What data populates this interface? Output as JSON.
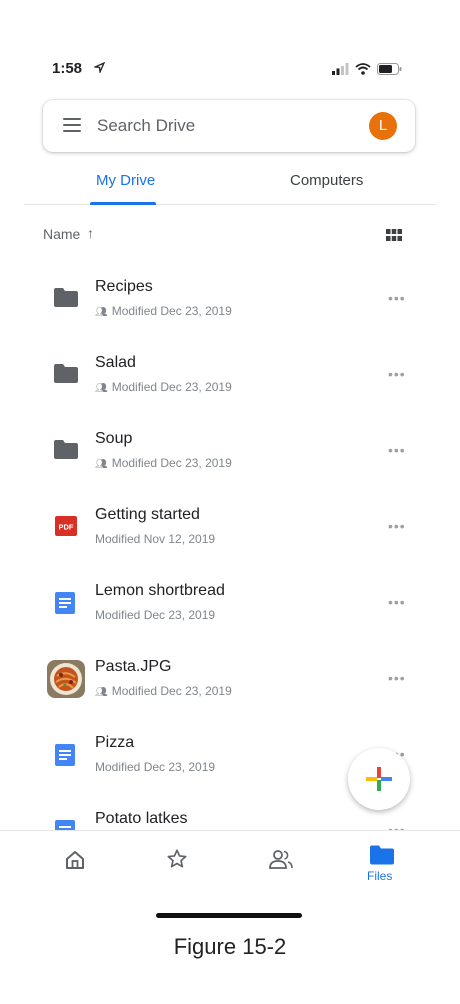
{
  "status_bar": {
    "time": "1:58"
  },
  "search": {
    "placeholder": "Search Drive",
    "avatar_letter": "L"
  },
  "tabs": [
    {
      "label": "My Drive",
      "active": true
    },
    {
      "label": "Computers",
      "active": false
    }
  ],
  "sort": {
    "label": "Name",
    "arrow": "↑"
  },
  "files": [
    {
      "name": "Recipes",
      "meta": "Modified Dec 23, 2019",
      "type": "folder",
      "shared": true
    },
    {
      "name": "Salad",
      "meta": "Modified Dec 23, 2019",
      "type": "folder",
      "shared": true
    },
    {
      "name": "Soup",
      "meta": "Modified Dec 23, 2019",
      "type": "folder",
      "shared": true
    },
    {
      "name": "Getting started",
      "meta": "Modified Nov 12, 2019",
      "type": "pdf",
      "shared": false
    },
    {
      "name": "Lemon shortbread",
      "meta": "Modified Dec 23, 2019",
      "type": "doc",
      "shared": false
    },
    {
      "name": "Pasta.JPG",
      "meta": "Modified Dec 23, 2019",
      "type": "image",
      "shared": true
    },
    {
      "name": "Pizza",
      "meta": "Modified Dec 23, 2019",
      "type": "doc",
      "shared": false
    },
    {
      "name": "Potato latkes",
      "meta": "",
      "type": "doc",
      "shared": false
    }
  ],
  "icons": {
    "more": "more-options-icon",
    "pdf_text": "PDF"
  },
  "bottom_nav": {
    "files_label": "Files",
    "items": [
      "home-icon",
      "star-icon",
      "shared-icon",
      "files-icon"
    ]
  },
  "caption": "Figure 15-2",
  "colors": {
    "accent": "#1a73e8",
    "avatar": "#e8710a",
    "folder": "#5f6368",
    "pdf": "#d93025",
    "doc": "#4285f4"
  }
}
